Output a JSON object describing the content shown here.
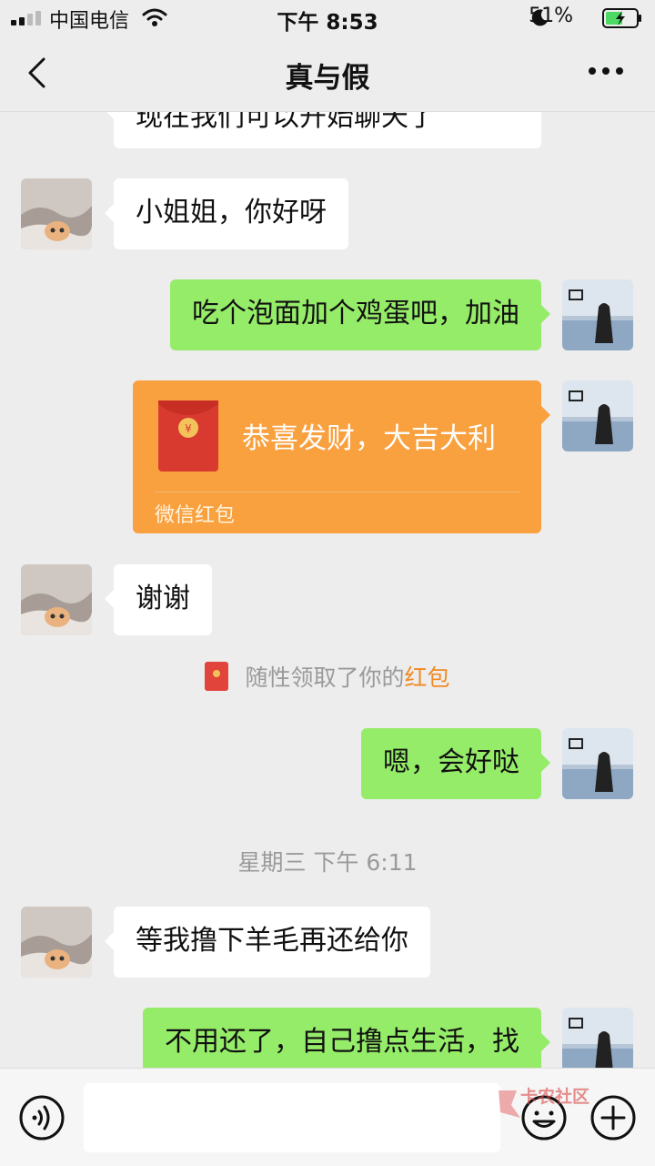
{
  "status_bar": {
    "carrier": "中国电信",
    "time": "下午 8:53",
    "battery": "51%"
  },
  "nav": {
    "title": "真与假"
  },
  "messages": {
    "m0": "现在我们可以开始聊天了",
    "m1": "小姐姐，你好呀",
    "m2": "吃个泡面加个鸡蛋吧，加油",
    "red_packet": {
      "greeting": "恭喜发财，大吉大利",
      "label": "微信红包"
    },
    "m3": "谢谢",
    "system_note": {
      "prefix": "随性领取了你的",
      "highlight": "红包"
    },
    "m4": "嗯，会好哒",
    "timestamp": "星期三 下午 6:11",
    "m5": "等我撸下羊毛再还给你",
    "m6": "不用还了，自己撸点生活，找"
  },
  "watermark": {
    "text": "卡农社区"
  },
  "colors": {
    "self_bubble": "#95ec69",
    "red_packet": "#f9a03f",
    "background": "#ededed"
  },
  "icons": {
    "back": "chevron-left-icon",
    "more": "more-dots-icon",
    "voice": "voice-icon",
    "emoji": "emoji-icon",
    "plus": "plus-icon"
  }
}
